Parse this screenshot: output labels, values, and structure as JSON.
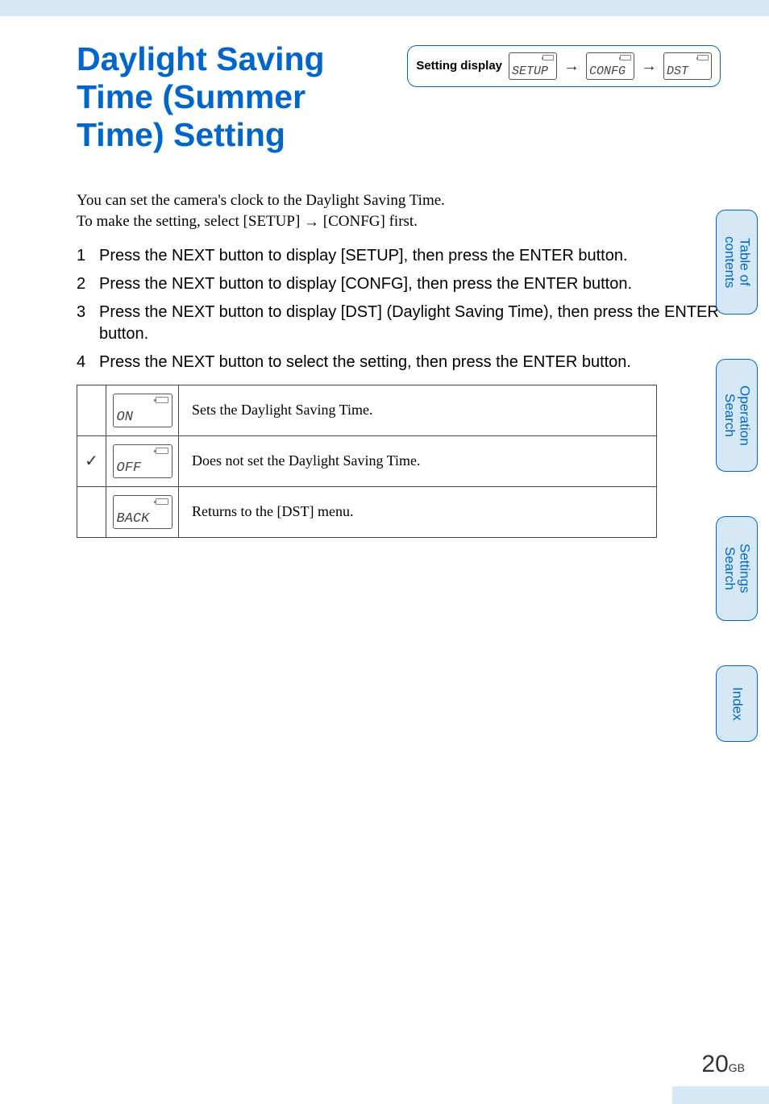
{
  "title": "Daylight Saving Time (Summer Time) Setting",
  "setting_display": {
    "label": "Setting display",
    "screens": [
      "SETUP",
      "CONFG",
      "DST"
    ]
  },
  "intro": {
    "line1": "You can set the camera's clock to the Daylight Saving Time.",
    "line2_pre": "To make the setting, select [SETUP] ",
    "line2_post": " [CONFG] first."
  },
  "steps": [
    "Press the NEXT button to display [SETUP], then press the ENTER button.",
    "Press the NEXT button to display [CONFG], then press the ENTER button.",
    "Press the NEXT button to display [DST] (Daylight Saving Time), then press the ENTER button.",
    "Press the NEXT button to select the setting, then press the ENTER button."
  ],
  "options": [
    {
      "mark": "",
      "screen": "ON",
      "desc": "Sets the Daylight Saving Time."
    },
    {
      "mark": "✓",
      "screen": "OFF",
      "desc": "Does not set the Daylight Saving Time."
    },
    {
      "mark": "",
      "screen": "BACK",
      "desc": "Returns to the [DST] menu."
    }
  ],
  "tabs": {
    "toc": "Table of contents",
    "op": "Operation Search",
    "set": "Settings Search",
    "idx": "Index"
  },
  "page": {
    "number": "20",
    "suffix": "GB"
  }
}
